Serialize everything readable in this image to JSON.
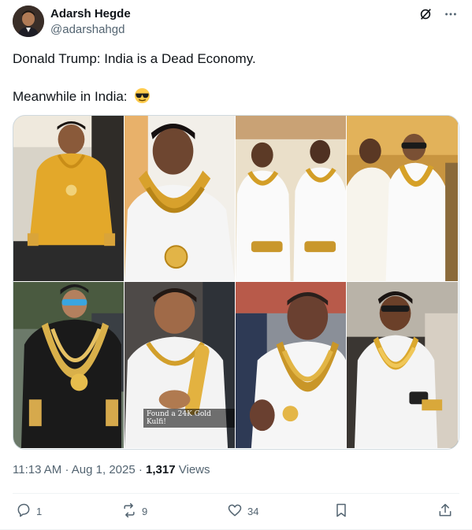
{
  "author": {
    "name": "Adarsh Hegde",
    "handle": "@adarshahgd"
  },
  "tweet": {
    "line1": "Donald Trump:  India is a Dead Economy.",
    "line2": "Meanwhile in India:",
    "emoji": "sunglasses-emoji"
  },
  "media": {
    "caption": "Found a 24K Gold Kulfi!",
    "photo_count": 8
  },
  "meta": {
    "time": "11:13 AM",
    "separator": "·",
    "date": "Aug 1, 2025",
    "dot": "·",
    "views_count": "1,317",
    "views_label": "Views"
  },
  "actions": {
    "replies": "1",
    "reposts": "9",
    "likes": "34"
  },
  "colors": {
    "text": "#0f1419",
    "secondary": "#536471",
    "border": "#cfd9de",
    "gold": "#d4a43a"
  }
}
